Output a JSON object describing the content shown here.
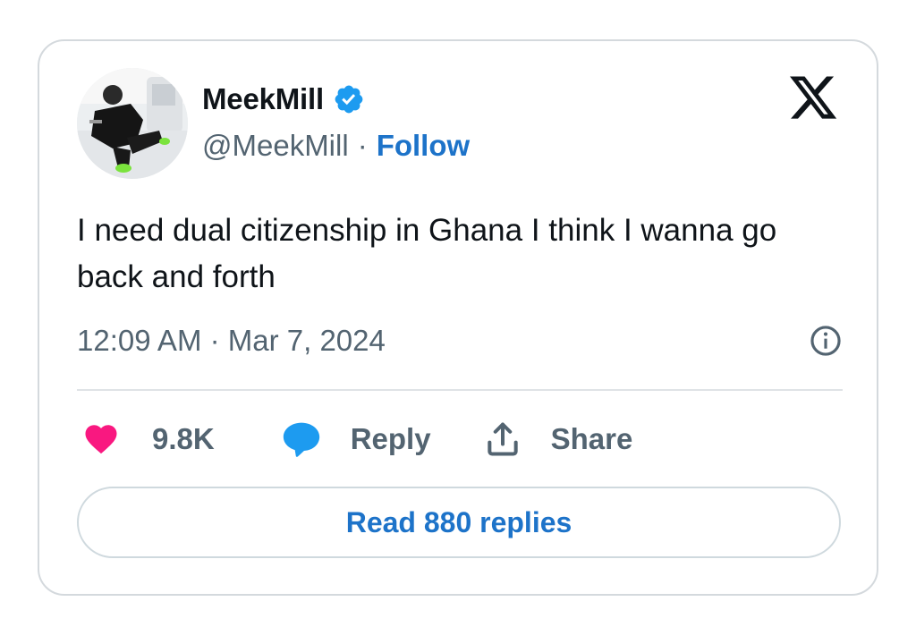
{
  "author": {
    "display_name": "MeekMill",
    "handle": "@MeekMill",
    "separator": "·",
    "follow_label": "Follow",
    "verified_color": "#1d9bf0"
  },
  "tweet": {
    "text": "I need dual citizenship in Ghana I think I wanna go back and forth",
    "timestamp": "12:09 AM · Mar 7, 2024"
  },
  "actions": {
    "like_count": "9.8K",
    "reply_label": "Reply",
    "share_label": "Share"
  },
  "read_replies_label": "Read 880 replies",
  "colors": {
    "accent": "#1d73c9",
    "like": "#f91880",
    "reply": "#1d9bf0",
    "secondary_text": "#536471"
  },
  "icons": {
    "logo": "x-logo-icon",
    "verified": "verified-badge-icon",
    "info": "info-icon",
    "like": "heart-icon",
    "reply": "speech-bubble-icon",
    "share": "share-upload-icon"
  }
}
